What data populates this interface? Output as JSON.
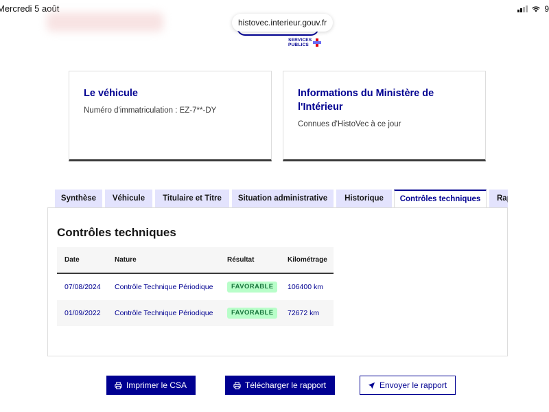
{
  "status_bar": {
    "date": "Mercredi 5 août",
    "battery": "9"
  },
  "browser": {
    "url": "histovec.interieur.gouv.fr"
  },
  "logo": {
    "line1": "SERVICES",
    "line2": "PUBLICS"
  },
  "cards": [
    {
      "title": "Le véhicule",
      "description": "Numéro d'immatriculation : EZ-7**-DY"
    },
    {
      "title": "Informations du Ministère de l'Intérieur",
      "description": "Connues d'HistoVec à ce jour"
    }
  ],
  "tabs": [
    {
      "label": "Synthèse"
    },
    {
      "label": "Véhicule"
    },
    {
      "label": "Titulaire et Titre"
    },
    {
      "label": "Situation administrative"
    },
    {
      "label": "Historique"
    },
    {
      "label": "Contrôles techniques",
      "active": true
    },
    {
      "label": "Rapport"
    }
  ],
  "panel": {
    "title": "Contrôles techniques",
    "table": {
      "headers": [
        "Date",
        "Nature",
        "Résultat",
        "Kilométrage"
      ],
      "rows": [
        {
          "date": "07/08/2024",
          "nature": "Contrôle Technique Périodique",
          "result": "FAVORABLE",
          "mileage": "106400 km"
        },
        {
          "date": "01/09/2022",
          "nature": "Contrôle Technique Périodique",
          "result": "FAVORABLE",
          "mileage": "72672 km"
        }
      ]
    }
  },
  "actions": {
    "print": "Imprimer le CSA",
    "download": "Télécharger le rapport",
    "send": "Envoyer le rapport"
  },
  "colors": {
    "primary": "#000091",
    "tab_bg": "#e3e3fd",
    "success_bg": "#b8fec9",
    "success_text": "#18753c"
  }
}
